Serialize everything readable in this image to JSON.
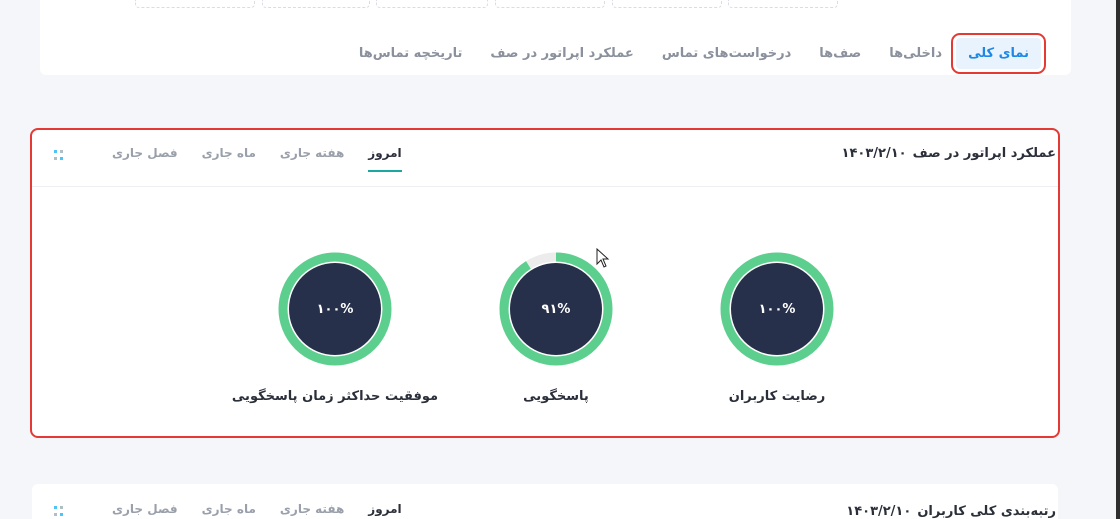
{
  "top_tabs": [
    {
      "label": "نمای کلی",
      "active": true
    },
    {
      "label": "داخلی‌ها",
      "active": false
    },
    {
      "label": "صف‌ها",
      "active": false
    },
    {
      "label": "درخواست‌های تماس",
      "active": false
    },
    {
      "label": "عملکرد اپراتور در صف",
      "active": false
    },
    {
      "label": "تاریخچه تماس‌ها",
      "active": false
    }
  ],
  "perf_card": {
    "title": "عملکرد اپراتور در صف",
    "date": "۱۴۰۳/۲/۱۰",
    "period_tabs": [
      "امروز",
      "هفته جاری",
      "ماه جاری",
      "فصل جاری"
    ],
    "active_period": "امروز",
    "gauges": [
      {
        "label": "رضایت کاربران",
        "value_text": "۱۰۰%",
        "percent": 100
      },
      {
        "label": "پاسخگویی",
        "value_text": "۹۱%",
        "percent": 91
      },
      {
        "label": "موفقیت حداکثر زمان پاسخگویی",
        "value_text": "۱۰۰%",
        "percent": 100
      }
    ]
  },
  "rank_card": {
    "title": "رتبه‌بندی کلی کاربران",
    "date": "۱۴۰۳/۲/۱۰",
    "period_tabs": [
      "امروز",
      "هفته جاری",
      "ماه جاری",
      "فصل جاری"
    ],
    "active_period": "امروز"
  },
  "colors": {
    "accent_blue": "#1e88e5",
    "gauge_ring": "#5ccf8f",
    "gauge_track": "#ececec",
    "gauge_center": "#27304a",
    "highlight_red": "#e53935",
    "period_underline": "#1ba8a0"
  },
  "icons": {
    "grid": "grid-dots-icon",
    "cursor": "mouse-pointer-icon"
  }
}
